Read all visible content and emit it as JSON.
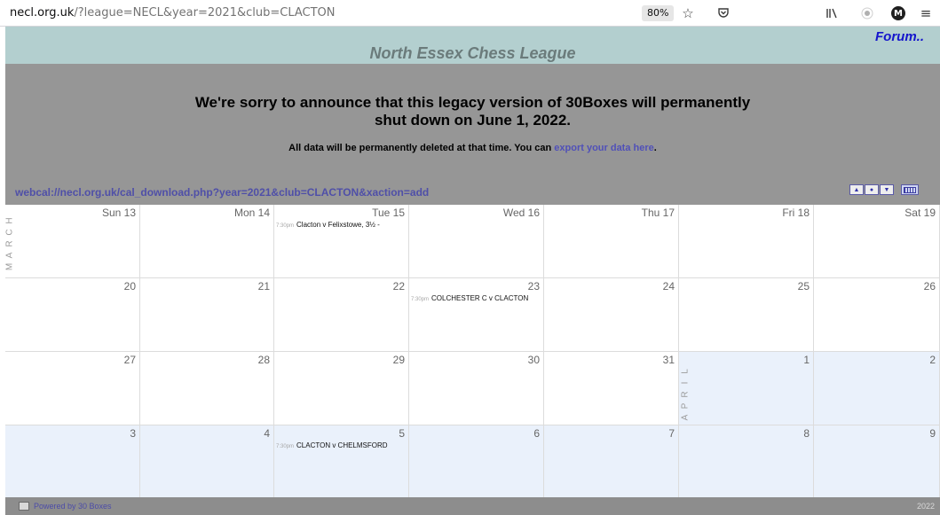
{
  "browser": {
    "url_host": "necl.org.uk",
    "url_path": "/?league=NECL&year=2021&club=CLACTON",
    "zoom": "80%"
  },
  "header": {
    "title": "North Essex Chess League",
    "forum_link": "Forum.."
  },
  "notice": {
    "heading_line1": "We're sorry to announce that this legacy version of 30Boxes will permanently",
    "heading_line2": "shut down on June 1, 2022.",
    "body_prefix": "All data will be permanently deleted at that time. You can ",
    "export_link": "export your data here",
    "body_suffix": "."
  },
  "webcal": {
    "link": "webcal://necl.org.uk/cal_download.php?year=2021&club=CLACTON&xaction=add"
  },
  "controls": {
    "up": "▲",
    "dot": "●",
    "down": "▼"
  },
  "calendar": {
    "weeks": [
      {
        "month_label": "MARCH",
        "days": [
          {
            "label": "Sun 13"
          },
          {
            "label": "Mon 14"
          },
          {
            "label": "Tue 15",
            "event_time": "7:30pm",
            "event_title": "Clacton v Felixstowe, 3½ -"
          },
          {
            "label": "Wed 16"
          },
          {
            "label": "Thu 17"
          },
          {
            "label": "Fri 18"
          },
          {
            "label": "Sat 19"
          }
        ]
      },
      {
        "days": [
          {
            "label": "20"
          },
          {
            "label": "21"
          },
          {
            "label": "22"
          },
          {
            "label": "23",
            "event_time": "7:30pm",
            "event_title": "COLCHESTER C v CLACTON"
          },
          {
            "label": "24"
          },
          {
            "label": "25"
          },
          {
            "label": "26"
          }
        ]
      },
      {
        "days": [
          {
            "label": "27"
          },
          {
            "label": "28"
          },
          {
            "label": "29"
          },
          {
            "label": "30"
          },
          {
            "label": "31"
          },
          {
            "label": "1",
            "month_label": "APRIL",
            "next_month": true
          },
          {
            "label": "2",
            "next_month": true
          }
        ]
      },
      {
        "days": [
          {
            "label": "3",
            "next_month": true
          },
          {
            "label": "4",
            "next_month": true
          },
          {
            "label": "5",
            "next_month": true,
            "event_time": "7:30pm",
            "event_title": "CLACTON v CHELMSFORD"
          },
          {
            "label": "6",
            "next_month": true
          },
          {
            "label": "7",
            "next_month": true
          },
          {
            "label": "8",
            "next_month": true
          },
          {
            "label": "9",
            "next_month": true
          }
        ]
      }
    ]
  },
  "footer": {
    "powered_by": "Powered by 30 Boxes",
    "year": "2022"
  }
}
